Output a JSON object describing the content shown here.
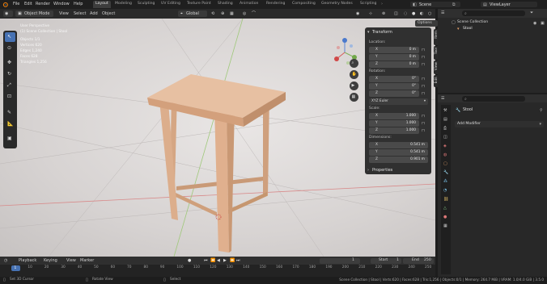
{
  "topbar": {
    "menus": [
      "File",
      "Edit",
      "Render",
      "Window",
      "Help"
    ],
    "workspaces": [
      "Layout",
      "Modeling",
      "Sculpting",
      "UV Editing",
      "Texture Paint",
      "Shading",
      "Animation",
      "Rendering",
      "Compositing",
      "Geometry Nodes",
      "Scripting"
    ],
    "active_workspace": "Layout",
    "scene_label": "Scene",
    "viewlayer_label": "ViewLayer"
  },
  "viewport_header": {
    "mode": "Object Mode",
    "menus": [
      "View",
      "Select",
      "Add",
      "Object"
    ],
    "orientation": "Global",
    "options": "Options"
  },
  "viewport": {
    "stats": [
      "User Perspective",
      "(1) Scene Collection | Stool",
      "Objects  1/1",
      "Vertices  620",
      "Edges  1,240",
      "Faces  628",
      "Triangles  1,256"
    ]
  },
  "npanel": {
    "tabs": [
      "Item",
      "Tool",
      "View",
      "Edit"
    ],
    "transform_title": "Transform",
    "location_label": "Location:",
    "location": [
      {
        "axis": "X",
        "value": "0 m"
      },
      {
        "axis": "Y",
        "value": "0 m"
      },
      {
        "axis": "Z",
        "value": "0 m"
      }
    ],
    "rotation_label": "Rotation:",
    "rotation": [
      {
        "axis": "X",
        "value": "0°"
      },
      {
        "axis": "Y",
        "value": "0°"
      },
      {
        "axis": "Z",
        "value": "0°"
      }
    ],
    "rotation_mode": "XYZ Euler",
    "scale_label": "Scale:",
    "scale": [
      {
        "axis": "X",
        "value": "1.000"
      },
      {
        "axis": "Y",
        "value": "1.000"
      },
      {
        "axis": "Z",
        "value": "1.000"
      }
    ],
    "dimensions_label": "Dimensions:",
    "dimensions": [
      {
        "axis": "X",
        "value": "0.541 m"
      },
      {
        "axis": "Y",
        "value": "0.541 m"
      },
      {
        "axis": "Z",
        "value": "0.901 m"
      }
    ],
    "properties_title": "Properties"
  },
  "outliner": {
    "root": "Scene Collection",
    "item": "Stool"
  },
  "properties": {
    "object_name": "Stool",
    "add_modifier": "Add Modifier"
  },
  "timeline": {
    "menus": [
      "Playback",
      "Keying",
      "View",
      "Marker"
    ],
    "current_frame": "1",
    "start_label": "Start",
    "start": "1",
    "end_label": "End",
    "end": "250",
    "ticks": [
      "1",
      "10",
      "20",
      "30",
      "40",
      "50",
      "60",
      "70",
      "80",
      "90",
      "100",
      "110",
      "120",
      "130",
      "140",
      "150",
      "160",
      "170",
      "180",
      "190",
      "200",
      "210",
      "220",
      "230",
      "240",
      "250"
    ]
  },
  "statusbar": {
    "left_items": [
      "Set 3D Cursor",
      "Rotate View",
      "Select"
    ],
    "right_text": "Scene Collection | Stool | Verts:620 | Faces:628 | Tris:1,256 | Objects:0/1 | Memory: 264.7 MiB | VRAM: 1.0/4.0 GiB | 3.5.0"
  },
  "colors": {
    "accent": "#4772b3",
    "wood": "#e0b08e"
  }
}
